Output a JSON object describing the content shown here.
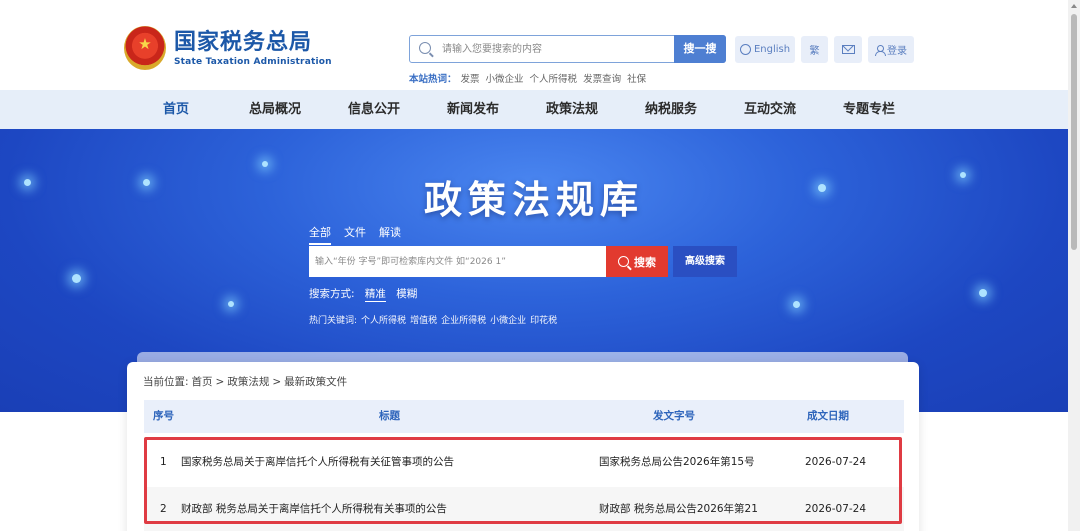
{
  "header": {
    "logo_cn": "国家税务总局",
    "logo_en": "State Taxation Administration",
    "search_placeholder": "请输入您要搜索的内容",
    "search_button": "搜一搜",
    "hotwords_label": "本站热词：",
    "hotwords": [
      "发票",
      "小微企业",
      "个人所得税",
      "发票查询",
      "社保"
    ],
    "english_label": "English",
    "traditional_label": "繁",
    "login_label": "登录"
  },
  "nav": {
    "items": [
      "首页",
      "总局概况",
      "信息公开",
      "新闻发布",
      "政策法规",
      "纳税服务",
      "互动交流",
      "专题专栏"
    ],
    "active": "首页"
  },
  "banner": {
    "title": "政策法规库",
    "tabs": [
      "全部",
      "文件",
      "解读"
    ],
    "active_tab": "全部",
    "search_placeholder": "输入“年份 字号”即可检索库内文件 如“2026 1”",
    "search_button": "搜索",
    "advanced_button": "高级搜索",
    "search_mode_label": "搜索方式:",
    "search_modes": [
      "精准",
      "模糊"
    ],
    "active_mode": "精准",
    "hot_keywords_label": "热门关键词:",
    "hot_keywords": [
      "个人所得税",
      "增值税",
      "企业所得税",
      "小微企业",
      "印花税"
    ]
  },
  "breadcrumb": {
    "label": "当前位置:",
    "items": [
      "首页",
      ">",
      "政策法规",
      ">",
      "最新政策文件"
    ]
  },
  "table": {
    "headers": [
      "序号",
      "标题",
      "发文字号",
      "成文日期"
    ],
    "rows": [
      {
        "index": "1",
        "title": "国家税务总局关于离岸信托个人所得税有关征管事项的公告",
        "doc_no": "国家税务总局公告2026年第15号",
        "date": "2026-07-24"
      },
      {
        "index": "2",
        "title": "财政部 税务总局关于离岸信托个人所得税有关事项的公告",
        "doc_no": "财政部 税务总局公告2026年第21",
        "date": "2026-07-24"
      }
    ]
  },
  "colors": {
    "brand_blue": "#1c58a8",
    "nav_bg": "#e6eef9",
    "search_red": "#e23a2f",
    "highlight_red": "#df3b43"
  }
}
